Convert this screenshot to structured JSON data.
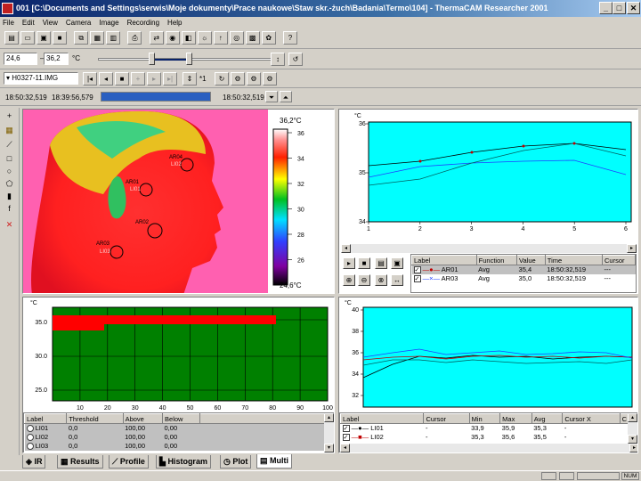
{
  "window": {
    "title": "001 [C:\\Documents and Settings\\serwis\\Moje dokumenty\\Prace naukowe\\Staw skr.-żuch\\Badania\\Termo\\104] - ThermaCAM Researcher  2001",
    "minimize": "_",
    "maximize": "□",
    "close": "✕"
  },
  "menu": [
    "File",
    "Edit",
    "View",
    "Camera",
    "Image",
    "Recording",
    "Help"
  ],
  "range": {
    "low": "24,6",
    "dash": "–",
    "high": "36,2",
    "unit": "°C"
  },
  "recording": {
    "filename": "H0327-11.IMG",
    "step": "*1"
  },
  "times": {
    "start": "18:50:32,519",
    "end": "18:39:56,579",
    "current": "18:50:32,519"
  },
  "status": {
    "num": "NUM"
  },
  "ir": {
    "scale_max": "36,2°C",
    "scale_min": "24,6°C",
    "ticks": [
      "36",
      "34",
      "32",
      "30",
      "28",
      "26"
    ],
    "spots": [
      {
        "label": "AR04",
        "sub": "LI02"
      },
      {
        "label": "AR01",
        "sub": "LI01"
      },
      {
        "label": "AR02",
        "sub": ""
      },
      {
        "label": "AR03",
        "sub": "LI03"
      }
    ]
  },
  "profile_chart": {
    "unit": "°C",
    "ticks_y": [
      "36",
      "35",
      "34"
    ],
    "ticks_x": [
      "1",
      "2",
      "3",
      "4",
      "5",
      "6"
    ],
    "legend": {
      "headers": [
        "Label",
        "Function",
        "Value",
        "Time",
        "Cursor"
      ],
      "rows": [
        {
          "label": "AR01",
          "function": "Avg",
          "value": "35,4",
          "time": "18:50:32,519",
          "cursor": "---"
        },
        {
          "label": "AR03",
          "function": "Avg",
          "value": "35,0",
          "time": "18:50:32,519",
          "cursor": "---"
        }
      ]
    }
  },
  "histogram": {
    "unit": "°C",
    "ticks_y": [
      "35.0",
      "30.0",
      "25.0"
    ],
    "ticks_x": [
      "10",
      "20",
      "30",
      "40",
      "50",
      "60",
      "70",
      "80",
      "90",
      "100"
    ],
    "table": {
      "headers": [
        "Label",
        "Threshold",
        "Above",
        "Below"
      ],
      "rows": [
        {
          "label": "LI01",
          "threshold": "0,0",
          "above": "100,00",
          "below": "0,00"
        },
        {
          "label": "LI02",
          "threshold": "0,0",
          "above": "100,00",
          "below": "0,00"
        },
        {
          "label": "LI03",
          "threshold": "0,0",
          "above": "100,00",
          "below": "0,00"
        }
      ]
    }
  },
  "profile_plot": {
    "unit": "°C",
    "ticks_y": [
      "40",
      "38",
      "36",
      "34",
      "32"
    ],
    "legend": {
      "headers": [
        "Label",
        "Cursor",
        "Min",
        "Max",
        "Avg",
        "Cursor X",
        "C"
      ],
      "rows": [
        {
          "label": "LI01",
          "cursor": "-",
          "min": "33,9",
          "max": "35,9",
          "avg": "35,3",
          "cursorx": "-"
        },
        {
          "label": "LI02",
          "cursor": "-",
          "min": "35,3",
          "max": "35,6",
          "avg": "35,5",
          "cursorx": "-"
        }
      ]
    }
  },
  "tabs": [
    "IR",
    "Results",
    "Profile",
    "Histogram",
    "Plot",
    "Multi"
  ],
  "colors": {
    "chart_bg": "#00ffff",
    "hist_bg": "#008000",
    "hist_bar": "#ff0000",
    "title_start": "#0a246a"
  }
}
